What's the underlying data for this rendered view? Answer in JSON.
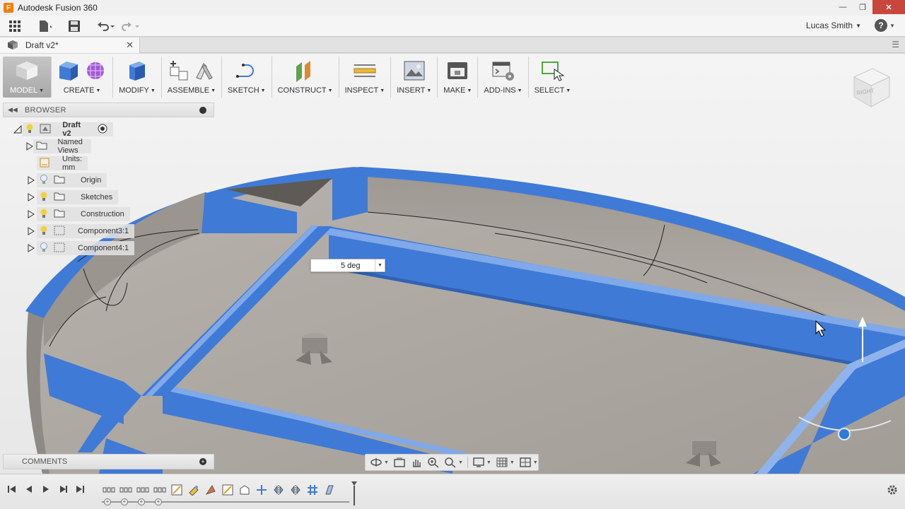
{
  "window": {
    "title": "Autodesk Fusion 360",
    "logo_letter": "F",
    "minimize": "—",
    "restore": "❐",
    "close": "✕"
  },
  "quick_access": {
    "user_name": "Lucas Smith",
    "help": "?"
  },
  "document_tab": {
    "name": "Draft v2*",
    "close": "✕"
  },
  "toolbar": {
    "groups": [
      {
        "id": "model",
        "label": "MODEL"
      },
      {
        "id": "create",
        "label": "CREATE"
      },
      {
        "id": "modify",
        "label": "MODIFY"
      },
      {
        "id": "assemble",
        "label": "ASSEMBLE"
      },
      {
        "id": "sketch",
        "label": "SKETCH"
      },
      {
        "id": "construct",
        "label": "CONSTRUCT"
      },
      {
        "id": "inspect",
        "label": "INSPECT"
      },
      {
        "id": "insert",
        "label": "INSERT"
      },
      {
        "id": "make",
        "label": "MAKE"
      },
      {
        "id": "addins",
        "label": "ADD-INS"
      },
      {
        "id": "select",
        "label": "SELECT"
      }
    ]
  },
  "browser": {
    "title": "BROWSER",
    "items": [
      {
        "label": "Draft v2",
        "bold": true
      },
      {
        "label": "Named Views"
      },
      {
        "label": "Units: mm"
      },
      {
        "label": "Origin"
      },
      {
        "label": "Sketches"
      },
      {
        "label": "Construction"
      },
      {
        "label": "Component3:1"
      },
      {
        "label": "Component4:1"
      }
    ]
  },
  "comments": {
    "title": "COMMENTS"
  },
  "draft_input": {
    "value": "5 deg"
  },
  "view_cube": {
    "face_label": "RIGHT"
  },
  "colors": {
    "accent_blue": "#3f7ad6",
    "body_gray": "#a9a49e",
    "close_red": "#c9463d"
  }
}
